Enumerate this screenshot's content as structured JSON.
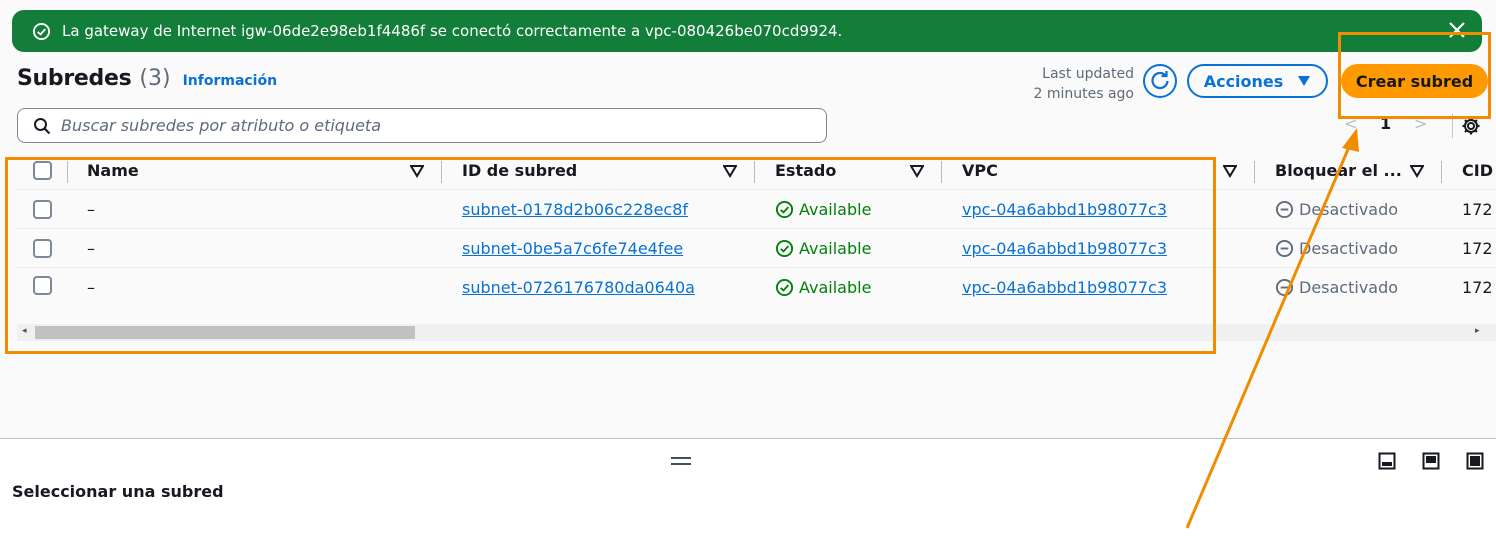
{
  "flash": {
    "message": "La gateway de Internet igw-06de2e98eb1f4486f se conectó correctamente a vpc-080426be070cd9924.",
    "status_color": "#137d3a"
  },
  "header": {
    "title": "Subredes",
    "count": "(3)",
    "info_link": "Información",
    "last_updated_label": "Last updated",
    "last_updated_value": "2 minutes ago",
    "actions_label": "Acciones",
    "create_label": "Crear subred"
  },
  "search": {
    "placeholder": "Buscar subredes por atributo o etiqueta"
  },
  "pagination": {
    "prev": "<",
    "current": "1",
    "next": ">"
  },
  "table": {
    "columns": [
      "Name",
      "ID de subred",
      "Estado",
      "VPC",
      "Bloquear el ...",
      "CID"
    ],
    "rows": [
      {
        "name": "–",
        "subnet_id": "subnet-0178d2b06c228ec8f",
        "status": "Available",
        "vpc": "vpc-04a6abbd1b98077c3",
        "block": "Desactivado",
        "cidr": "172"
      },
      {
        "name": "–",
        "subnet_id": "subnet-0be5a7c6fe74e4fee",
        "status": "Available",
        "vpc": "vpc-04a6abbd1b98077c3",
        "block": "Desactivado",
        "cidr": "172"
      },
      {
        "name": "–",
        "subnet_id": "subnet-0726176780da0640a",
        "status": "Available",
        "vpc": "vpc-04a6abbd1b98077c3",
        "block": "Desactivado",
        "cidr": "172"
      }
    ]
  },
  "detail": {
    "title": "Seleccionar una subred"
  },
  "colors": {
    "accent": "#0972d3",
    "primary_button": "#ff9900",
    "available": "#037f0c",
    "annotation": "#f08c00"
  },
  "icons": {
    "flash": "check-circle-icon",
    "close": "close-icon",
    "refresh": "refresh-icon",
    "actions": "caret-down-icon",
    "search": "search-icon",
    "settings": "gear-icon",
    "status": "check-circle-icon",
    "block": "minus-circle-icon"
  }
}
